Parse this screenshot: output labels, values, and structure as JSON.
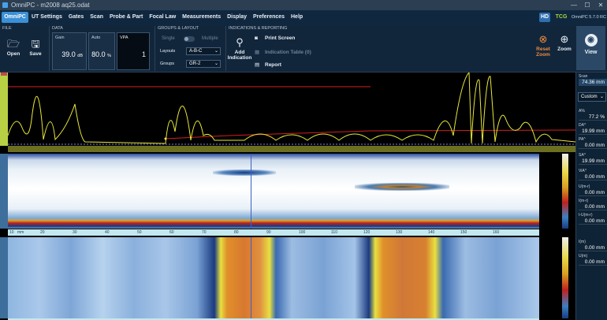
{
  "window": {
    "title": "OmniPC - m2008 aq25.odat",
    "minimize": "—",
    "maximize": "☐",
    "close": "✕"
  },
  "menu": {
    "brand": "OmniPC",
    "items": [
      "UT Settings",
      "Gates",
      "Scan",
      "Probe & Part",
      "Focal Law",
      "Measurements",
      "Display",
      "Preferences",
      "Help"
    ],
    "hd": "HD",
    "tcg": "TCG",
    "version": "OmniPC 5.7.0 RC"
  },
  "ribbon": {
    "file": {
      "label": "FILE",
      "open": "Open",
      "save": "Save"
    },
    "data": {
      "label": "DATA",
      "gain_label": "Gain",
      "gain_value": "39.0",
      "gain_unit": "dB",
      "auto_label": "Auto",
      "auto_value": "80.0",
      "auto_unit": "%",
      "vpa_label": "VPA",
      "vpa_value": "1"
    },
    "groups_layout": {
      "label": "GROUPS & LAYOUT",
      "single": "Single",
      "multiple": "Multiple",
      "layouts_label": "Layouts",
      "layouts_value": "A-B-C",
      "groups_label": "Groups",
      "groups_value": "GR-2"
    },
    "indications": {
      "label": "INDICATIONS & REPORTING",
      "add_indication": "Add Indication",
      "print_screen": "Print Screen",
      "indication_table": "Indication Table (0)",
      "report": "Report"
    },
    "reset_zoom": "Reset Zoom",
    "zoom": "Zoom",
    "view": "View"
  },
  "accent": "#3b8fd6",
  "scan_rulers": {
    "top_ticks": [
      "10",
      "20",
      "30",
      "40",
      "50",
      "60",
      "70",
      "80",
      "90",
      "100",
      "110",
      "120",
      "130",
      "140",
      "150",
      "160"
    ],
    "unit": "mm"
  },
  "readings": {
    "scan_label": "Scan",
    "scan_value": "74.36 mm",
    "mode": "Custom",
    "items": [
      {
        "label": "A%",
        "value": "77.2 %"
      },
      {
        "label": "DA^",
        "value": "19.99 mm"
      },
      {
        "label": "PA^",
        "value": "0.00 mm"
      },
      {
        "label": "SA^",
        "value": "19.99 mm"
      },
      {
        "label": "ViA^",
        "value": "0.00 mm"
      },
      {
        "label": "U(m-r)",
        "value": "0.00 mm"
      },
      {
        "label": "I(m-r)",
        "value": "0.00 mm"
      },
      {
        "label": "I-U(m-r)",
        "value": "0.00 mm"
      },
      {
        "label": "I(m)",
        "value": "0.00 mm"
      },
      {
        "label": "U(m)",
        "value": "0.00 mm"
      }
    ]
  }
}
